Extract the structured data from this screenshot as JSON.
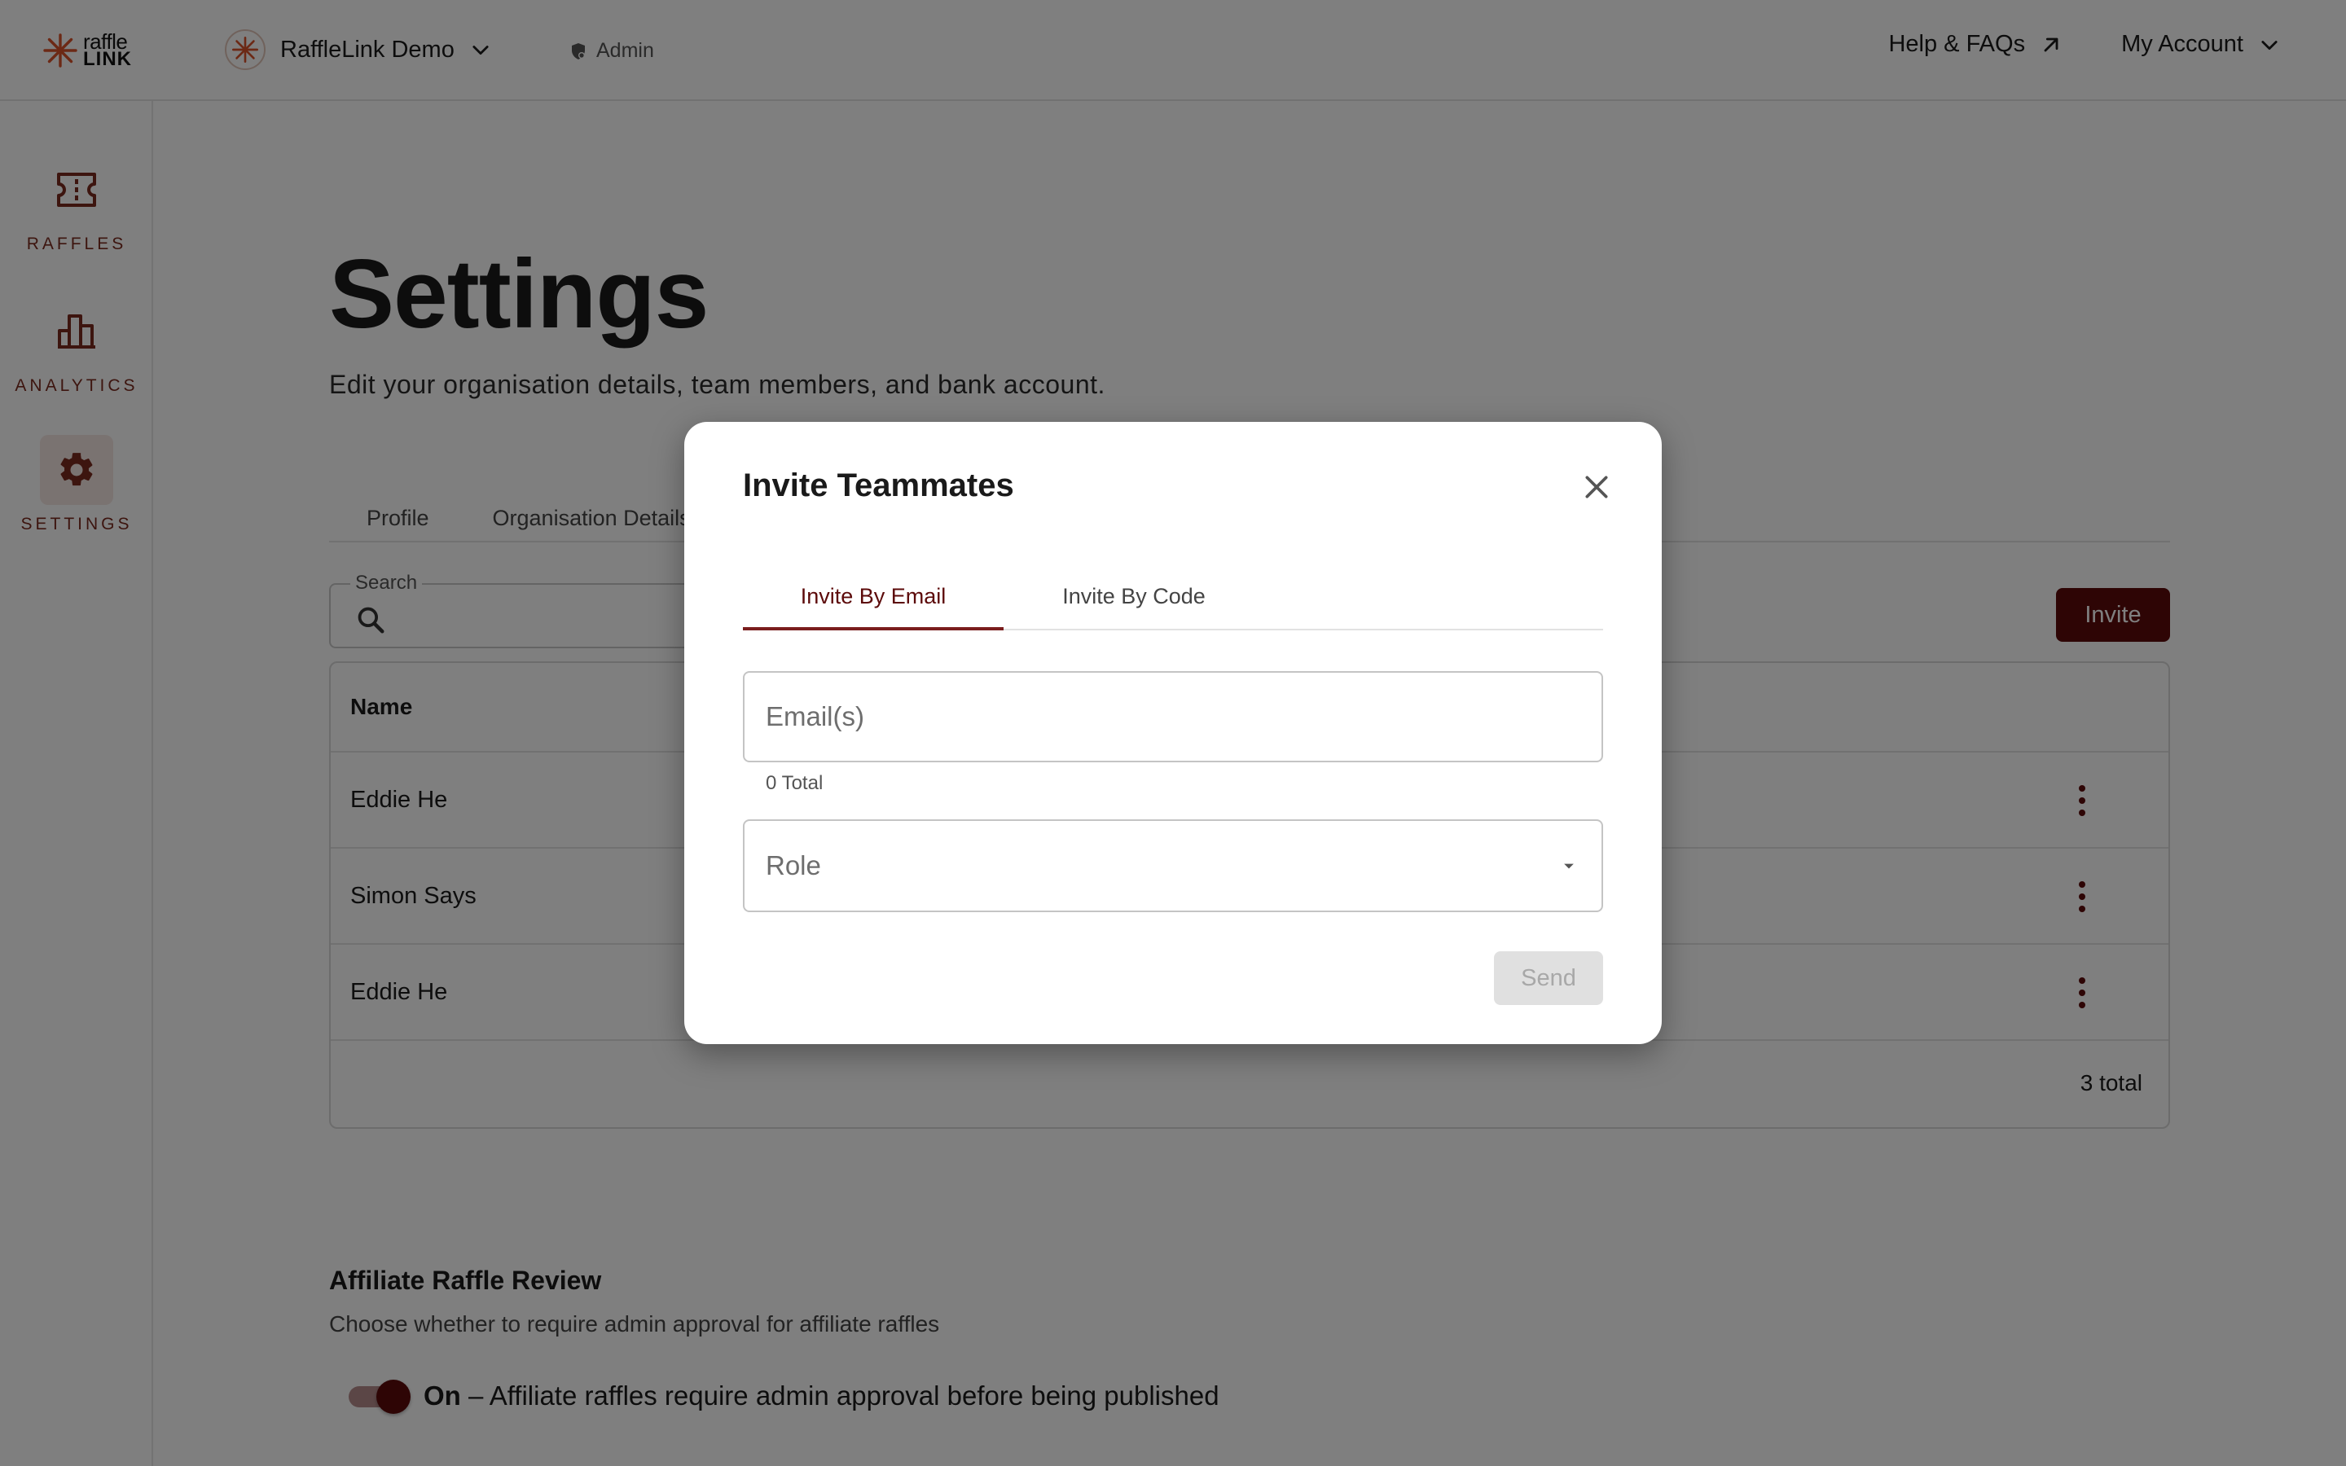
{
  "header": {
    "logo": {
      "line1": "raffle",
      "line2": "LINK"
    },
    "org_name": "RaffleLink Demo",
    "role": "Admin",
    "help_link": "Help & FAQs",
    "account_menu": "My Account"
  },
  "sidebar": {
    "items": [
      {
        "label": "RAFFLES",
        "icon": "ticket-icon",
        "active": false
      },
      {
        "label": "ANALYTICS",
        "icon": "bar-chart-icon",
        "active": false
      },
      {
        "label": "SETTINGS",
        "icon": "gear-icon",
        "active": true
      }
    ]
  },
  "page": {
    "title": "Settings",
    "subtitle": "Edit your organisation details, team members, and bank account.",
    "tabs": [
      {
        "label": "Profile"
      },
      {
        "label": "Organisation Details"
      }
    ],
    "search": {
      "label": "Search",
      "value": ""
    },
    "invite_button": "Invite",
    "table": {
      "columns": [
        "Name"
      ],
      "rows": [
        {
          "name": "Eddie He"
        },
        {
          "name": "Simon Says"
        },
        {
          "name": "Eddie He"
        }
      ],
      "total": "3 total"
    },
    "affiliate": {
      "title": "Affiliate Raffle Review",
      "description": "Choose whether to require admin approval for affiliate raffles",
      "toggle_state": "On",
      "toggle_text": " – Affiliate raffles require admin approval before being published",
      "enabled": true
    }
  },
  "modal": {
    "title": "Invite Teammates",
    "tabs": [
      {
        "label": "Invite By Email",
        "active": true
      },
      {
        "label": "Invite By Code",
        "active": false
      }
    ],
    "email_placeholder": "Email(s)",
    "email_value": "",
    "email_count": "0 Total",
    "role_placeholder": "Role",
    "send_button": "Send",
    "send_enabled": false
  },
  "colors": {
    "brand": "#5c0a0a",
    "brand_accent": "#7a2a1e",
    "logo_orange": "#d9532b",
    "overlay": "rgba(0,0,0,0.5)"
  }
}
